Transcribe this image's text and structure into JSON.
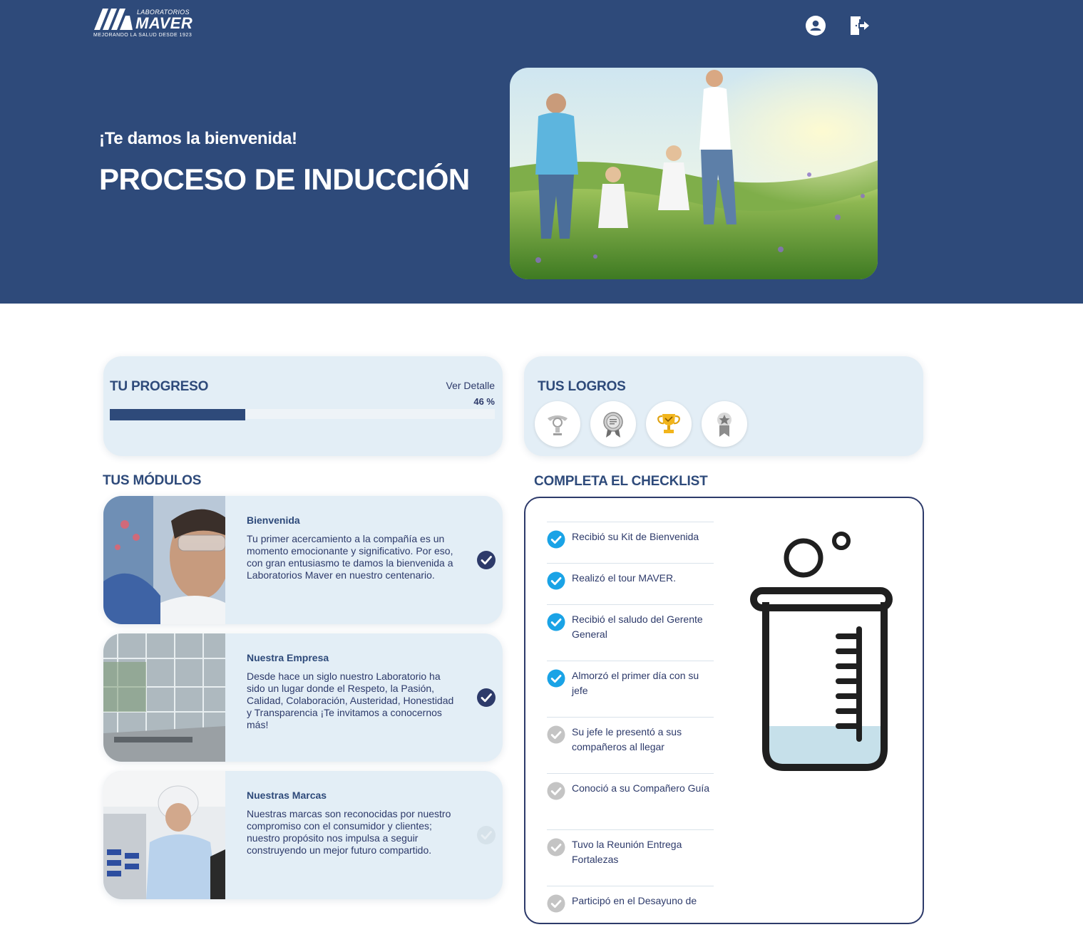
{
  "header": {
    "logo": {
      "lab": "LABORATORIOS",
      "brand": "MAVER",
      "tagline": "MEJORANDO LA SALUD DESDE 1923"
    },
    "icons": [
      "user-icon",
      "logout-icon"
    ]
  },
  "hero": {
    "welcome": "¡Te damos la bienvenida!",
    "title": "PROCESO DE INDUCCIÓN"
  },
  "progress": {
    "title": "TU PROGRESO",
    "detail_link": "Ver Detalle",
    "percent_label": "46 %",
    "value": 0.46
  },
  "achievements": {
    "title": "TUS LOGROS",
    "badges": [
      "lightbulb-badge-icon",
      "certificate-badge-icon",
      "trophy-badge-icon",
      "star-ribbon-badge-icon"
    ]
  },
  "modules": {
    "title": "TUS MÓDULOS",
    "items": [
      {
        "title": "Bienvenida",
        "description": "Tu primer acercamiento a la compañía es un momento emocionante y significativo. Por eso, con gran entusiasmo te damos la bienvenida a Laboratorios Maver en nuestro centenario.",
        "completed": true
      },
      {
        "title": "Nuestra Empresa",
        "description": "Desde hace un siglo nuestro Laboratorio ha sido un lugar donde el Respeto, la Pasión, Calidad, Colaboración, Austeridad, Honestidad y Transparencia ¡Te invitamos a conocernos más!",
        "completed": true
      },
      {
        "title": "Nuestras Marcas",
        "description": "Nuestras marcas son reconocidas por nuestro compromiso con el consumidor y clientes; nuestro propósito nos impulsa a seguir construyendo un mejor futuro compartido.",
        "completed": false
      }
    ]
  },
  "checklist": {
    "title": "COMPLETA EL CHECKLIST",
    "items": [
      {
        "label": "Recibió su Kit de Bienvenida",
        "done": true
      },
      {
        "label": "Realizó el tour MAVER.",
        "done": true
      },
      {
        "label": "Recibió el saludo del Gerente General",
        "done": true
      },
      {
        "label": "Almorzó el primer día con su jefe",
        "done": true
      },
      {
        "label": "Su jefe le presentó a sus compañeros al llegar",
        "done": false
      },
      {
        "label": "Conoció a su Compañero Guía",
        "done": false
      },
      {
        "label": "Tuvo la Reunión Entrega Fortalezas",
        "done": false
      },
      {
        "label": "Participó en el Desayuno de",
        "done": false
      }
    ],
    "fill_level": 0.25
  },
  "colors": {
    "navy": "#2e4a7a",
    "card": "#e3eef6",
    "check_done": "#1aa3e6",
    "check_pending": "#c4c4c4",
    "module_check": "#2d3a6a"
  }
}
